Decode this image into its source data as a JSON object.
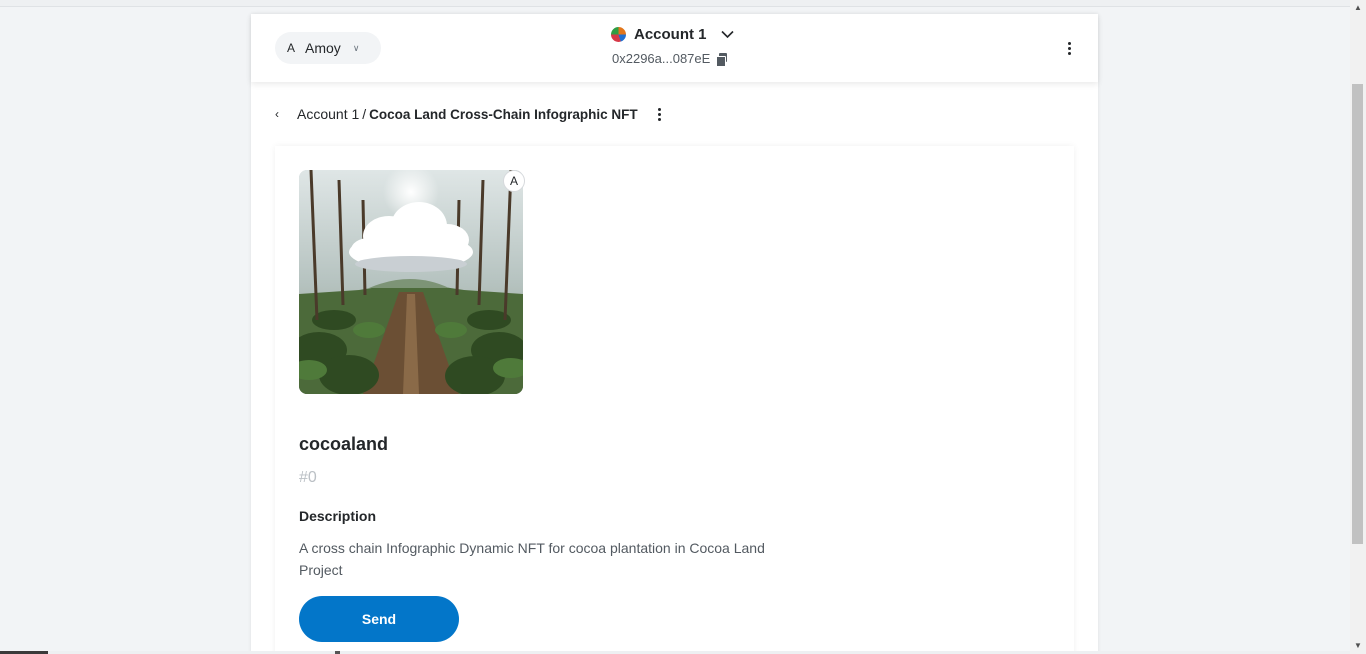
{
  "header": {
    "network": {
      "avatar_letter": "A",
      "name": "Amoy"
    },
    "account": {
      "name": "Account 1",
      "address": "0x2296a...087eE"
    }
  },
  "breadcrumb": {
    "account": "Account 1",
    "separator": "/",
    "current": "Cocoa Land Cross-Chain Infographic NFT"
  },
  "nft": {
    "badge_letter": "A",
    "name": "cocoaland",
    "token_id": "#0",
    "description_title": "Description",
    "description": "A cross chain Infographic Dynamic NFT for cocoa plantation in Cocoa Land Project"
  },
  "actions": {
    "send_label": "Send"
  },
  "icons": {
    "network_chevron": "chevron-down-icon",
    "account_chevron": "chevron-down-icon",
    "copy": "copy-icon",
    "menu": "kebab-menu-icon",
    "back": "chevron-left-icon"
  },
  "colors": {
    "primary": "#0376c9",
    "text": "#24272a",
    "muted": "#535a61",
    "token_id": "#bbc0c5",
    "background": "#f2f4f6"
  }
}
